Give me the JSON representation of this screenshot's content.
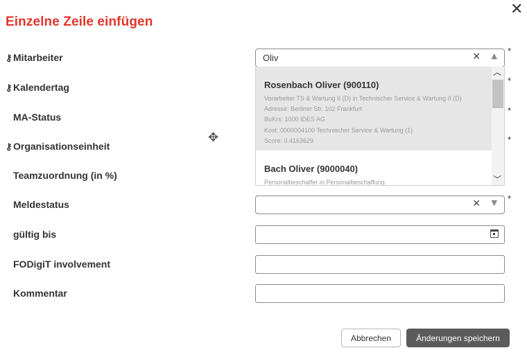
{
  "dialog": {
    "title": "Einzelne Zeile einfügen",
    "close_glyph": "✕"
  },
  "icons": {
    "key": "key-icon",
    "move": "move-icon",
    "calendar": "calendar-icon"
  },
  "colors": {
    "title": "#e0362b",
    "save_button": "#5b5b5b",
    "highlight": "#e6e6e6"
  },
  "required_marker": "*",
  "fields": {
    "mitarbeiter": {
      "label": "Mitarbeiter",
      "value": "Oliv"
    },
    "kalendertag": {
      "label": "Kalendertag"
    },
    "ma_status": {
      "label": "MA-Status"
    },
    "organisationseinheit": {
      "label": "Organisationseinheit"
    },
    "teamzuordnung": {
      "label": "Teamzuordnung (in %)"
    },
    "meldestatus": {
      "label": "Meldestatus",
      "value": ""
    },
    "gueltig_bis": {
      "label": "gültig bis",
      "value": ""
    },
    "fodigit": {
      "label": "FODigiT involvement",
      "value": ""
    },
    "kommentar": {
      "label": "Kommentar",
      "value": ""
    }
  },
  "dropdown": {
    "options": [
      {
        "name": "Rosenbach Oliver (900110)",
        "lines": [
          "Vorarbeiter TS & Wartung II (D) in Technischer Service & Wartung II (D)",
          "Adresse: Berliner Str. 102 Frankfurt",
          "BuKrs: 1000 IDES AG",
          "Kost: 0000004100 Technischer Service & Wartung (1)",
          "Score: 0.4163629"
        ]
      },
      {
        "name": "Bach Oliver (9000040)",
        "lines": [
          "Personalbeschaffer in Personalbeschaffung"
        ]
      }
    ]
  },
  "buttons": {
    "cancel": "Abbrechen",
    "save": "Änderungen speichern"
  }
}
